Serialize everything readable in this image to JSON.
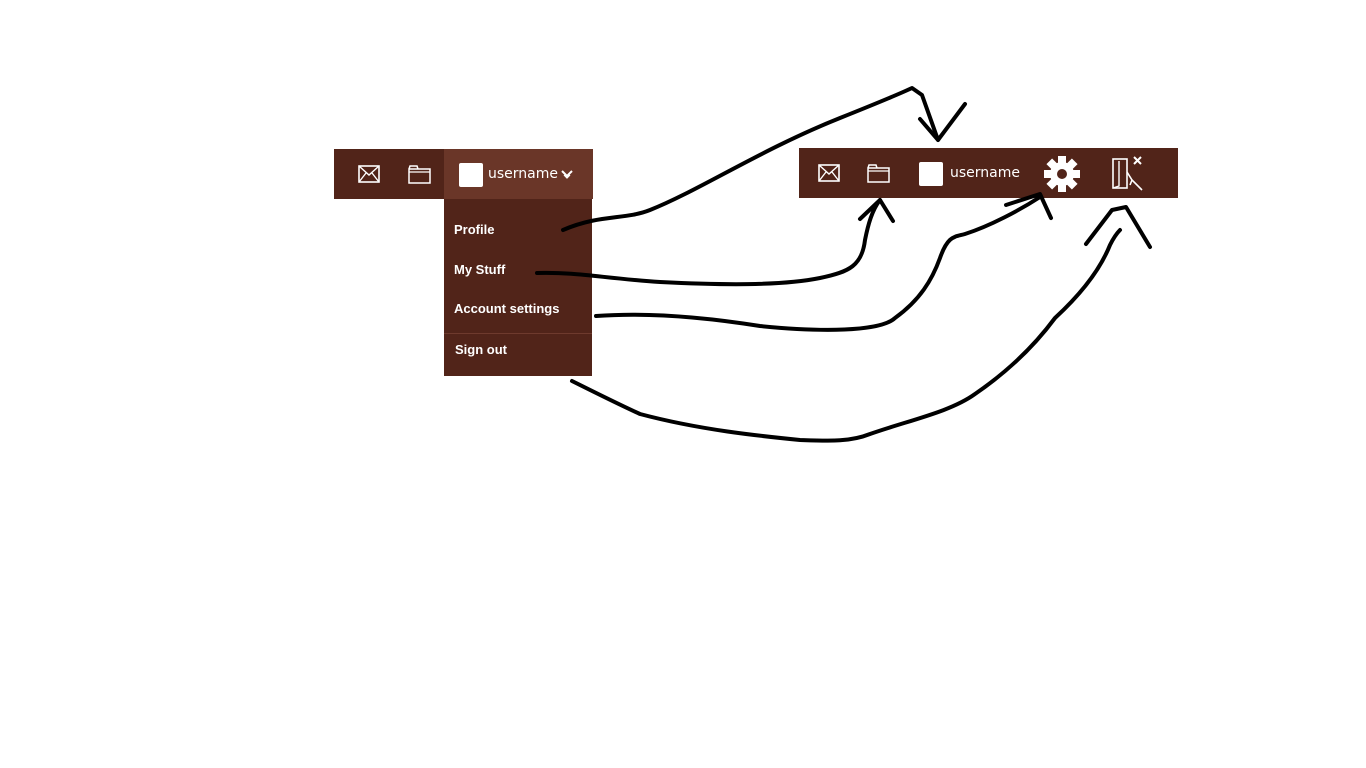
{
  "toolbar_old": {
    "username": "username",
    "icons": [
      "mail-icon",
      "folder-icon",
      "avatar",
      "chevron-down-icon"
    ]
  },
  "dropdown": {
    "items": [
      {
        "label": "Profile"
      },
      {
        "label": "My Stuff"
      },
      {
        "label": "Account settings"
      },
      {
        "label": "Sign out"
      }
    ]
  },
  "toolbar_new": {
    "username": "username",
    "icons": [
      "mail-icon",
      "folder-icon",
      "avatar",
      "gear-icon",
      "sign-out-icon"
    ]
  },
  "colors": {
    "bar_background": "#512419",
    "user_toggle_background": "#6a3628",
    "text": "#ffffff",
    "annotation_stroke": "#000000"
  }
}
